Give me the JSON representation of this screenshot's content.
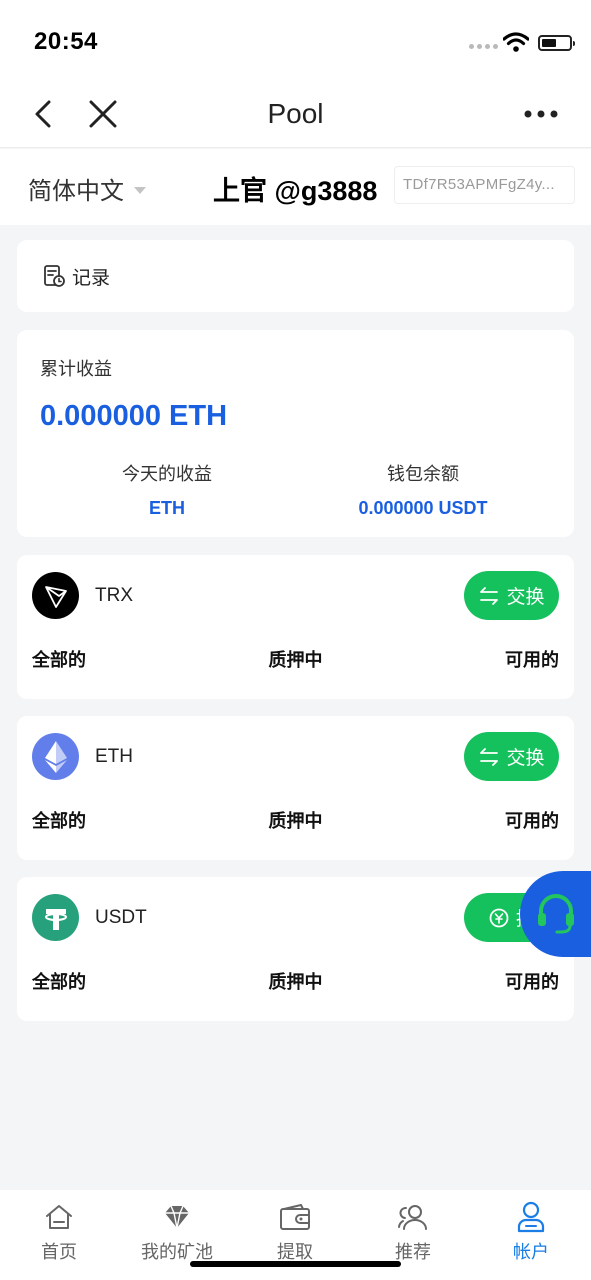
{
  "status_bar": {
    "time": "20:54"
  },
  "nav": {
    "title": "Pool"
  },
  "header": {
    "language": "简体中文",
    "user": "上官 @g3888",
    "address": "TDf7R53APMFgZ4y..."
  },
  "records": {
    "label": "记录"
  },
  "earnings": {
    "title": "累计收益",
    "total": "0.000000 ETH",
    "today_label": "今天的收益",
    "today_value": "ETH",
    "wallet_label": "钱包余额",
    "wallet_value": "0.000000 USDT"
  },
  "coins": [
    {
      "name": "TRX",
      "action": "交换",
      "total_label": "全部的",
      "staked_label": "质押中",
      "available_label": "可用的",
      "color": "#000000"
    },
    {
      "name": "ETH",
      "action": "交换",
      "total_label": "全部的",
      "staked_label": "质押中",
      "available_label": "可用的",
      "color": "#627eea"
    },
    {
      "name": "USDT",
      "action": "提",
      "total_label": "全部的",
      "staked_label": "质押中",
      "available_label": "可用的",
      "color": "#26a17b"
    }
  ],
  "tabs": [
    {
      "label": "首页",
      "icon": "home-icon"
    },
    {
      "label": "我的矿池",
      "icon": "diamond-icon"
    },
    {
      "label": "提取",
      "icon": "wallet-icon"
    },
    {
      "label": "推荐",
      "icon": "users-icon"
    },
    {
      "label": "帐户",
      "icon": "account-icon",
      "active": true
    }
  ],
  "colors": {
    "accent_blue": "#1a5fe0",
    "tab_active": "#1a7ee6",
    "action_green": "#15c15d",
    "support_green": "#22c55e"
  }
}
